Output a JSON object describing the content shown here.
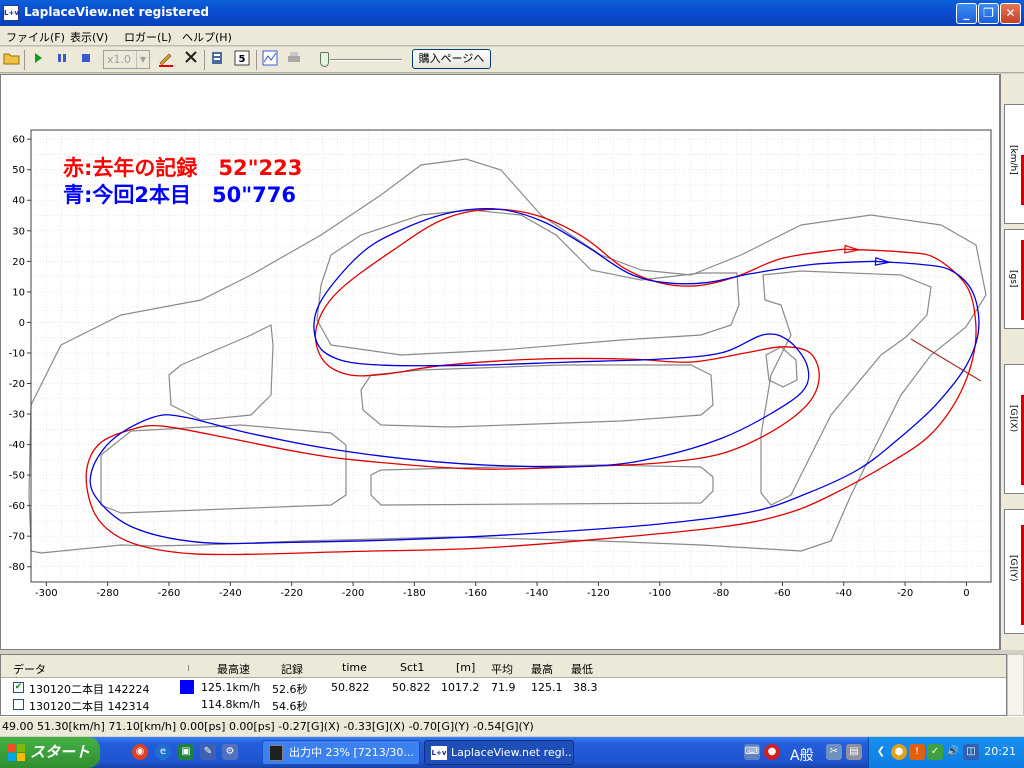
{
  "window": {
    "title": "LaplaceView.net registered",
    "icon_text": "L+v"
  },
  "menu": [
    "ファイル(F)",
    "表示(V)",
    "ロガー(L)",
    "ヘルプ(H)"
  ],
  "toolbar": {
    "speed_value": "x1.0",
    "buy_button": "購入ページへ"
  },
  "chart_data": {
    "type": "line",
    "xlim": [
      -305,
      8
    ],
    "ylim": [
      -85,
      63
    ],
    "x_ticks": [
      -300,
      -280,
      -260,
      -240,
      -220,
      -200,
      -180,
      -160,
      -140,
      -120,
      -100,
      -80,
      -60,
      -40,
      -20,
      0
    ],
    "y_ticks": [
      60,
      50,
      40,
      30,
      20,
      10,
      0,
      -10,
      -20,
      -30,
      -40,
      -50,
      -60,
      -70,
      -80
    ],
    "grid": true,
    "annotations": [
      {
        "text": "赤:去年の記録　52\"223",
        "color": "#ff0000"
      },
      {
        "text": "青:今回2本目　50\"776",
        "color": "#0000ff"
      }
    ],
    "series": [
      {
        "name": "赤:去年の記録",
        "color": "#e00000",
        "points": [
          [
            -40,
            24
          ],
          [
            -20,
            23
          ],
          [
            -10,
            21
          ],
          [
            0,
            12
          ],
          [
            3,
            0
          ],
          [
            2,
            -12
          ],
          [
            -3,
            -25
          ],
          [
            -12,
            -37
          ],
          [
            -25,
            -46
          ],
          [
            -45,
            -57
          ],
          [
            -60,
            -63
          ],
          [
            -80,
            -67
          ],
          [
            -120,
            -71
          ],
          [
            -160,
            -74
          ],
          [
            -200,
            -75
          ],
          [
            -240,
            -76
          ],
          [
            -260,
            -75
          ],
          [
            -275,
            -71
          ],
          [
            -284,
            -63
          ],
          [
            -287,
            -50
          ],
          [
            -283,
            -40
          ],
          [
            -272,
            -35
          ],
          [
            -262,
            -34
          ],
          [
            -240,
            -38
          ],
          [
            -220,
            -42
          ],
          [
            -200,
            -45
          ],
          [
            -160,
            -48
          ],
          [
            -120,
            -47
          ],
          [
            -100,
            -46
          ],
          [
            -80,
            -43
          ],
          [
            -64,
            -36
          ],
          [
            -52,
            -27
          ],
          [
            -48,
            -18
          ],
          [
            -51,
            -10
          ],
          [
            -60,
            -8
          ],
          [
            -72,
            -10
          ],
          [
            -90,
            -13
          ],
          [
            -110,
            -12
          ],
          [
            -140,
            -12
          ],
          [
            -170,
            -14
          ],
          [
            -190,
            -17
          ],
          [
            -202,
            -17
          ],
          [
            -210,
            -12
          ],
          [
            -212,
            -2
          ],
          [
            -205,
            10
          ],
          [
            -185,
            25
          ],
          [
            -170,
            34
          ],
          [
            -155,
            37
          ],
          [
            -140,
            35
          ],
          [
            -125,
            28
          ],
          [
            -112,
            18
          ],
          [
            -100,
            13
          ],
          [
            -88,
            12
          ],
          [
            -75,
            15
          ],
          [
            -60,
            21
          ],
          [
            -40,
            24
          ]
        ]
      },
      {
        "name": "青:今回2本目",
        "color": "#0000e0",
        "points": [
          [
            -30,
            20
          ],
          [
            -15,
            19
          ],
          [
            -5,
            17
          ],
          [
            2,
            10
          ],
          [
            4,
            -2
          ],
          [
            0,
            -14
          ],
          [
            -10,
            -27
          ],
          [
            -22,
            -38
          ],
          [
            -35,
            -48
          ],
          [
            -52,
            -56
          ],
          [
            -70,
            -62
          ],
          [
            -100,
            -66
          ],
          [
            -140,
            -69
          ],
          [
            -180,
            -71
          ],
          [
            -220,
            -72
          ],
          [
            -250,
            -72
          ],
          [
            -272,
            -67
          ],
          [
            -284,
            -57
          ],
          [
            -285,
            -48
          ],
          [
            -278,
            -38
          ],
          [
            -265,
            -31
          ],
          [
            -255,
            -31
          ],
          [
            -235,
            -36
          ],
          [
            -210,
            -41
          ],
          [
            -180,
            -45
          ],
          [
            -150,
            -47
          ],
          [
            -120,
            -47
          ],
          [
            -100,
            -44
          ],
          [
            -80,
            -38
          ],
          [
            -64,
            -30
          ],
          [
            -53,
            -22
          ],
          [
            -52,
            -14
          ],
          [
            -58,
            -6
          ],
          [
            -66,
            -4
          ],
          [
            -80,
            -10
          ],
          [
            -100,
            -12
          ],
          [
            -130,
            -13
          ],
          [
            -160,
            -14
          ],
          [
            -190,
            -14
          ],
          [
            -205,
            -12
          ],
          [
            -212,
            -6
          ],
          [
            -211,
            6
          ],
          [
            -198,
            22
          ],
          [
            -185,
            30
          ],
          [
            -168,
            36
          ],
          [
            -152,
            37
          ],
          [
            -138,
            33
          ],
          [
            -124,
            25
          ],
          [
            -110,
            16
          ],
          [
            -98,
            13
          ],
          [
            -85,
            13
          ],
          [
            -70,
            16
          ],
          [
            -50,
            19
          ],
          [
            -30,
            20
          ]
        ]
      }
    ]
  },
  "side_panel": {
    "labels": [
      "[km/h]",
      "[gs]",
      "[G](X)",
      "[G](Y)"
    ]
  },
  "table": {
    "headers": [
      "データ",
      "",
      "最高速",
      "記録",
      "time",
      "Sct1",
      "[m]",
      "平均",
      "最高",
      "最低"
    ],
    "rows": [
      {
        "checked": true,
        "name": "130120二本目 142224",
        "color": "#0000ff",
        "top_speed": "125.1km/h",
        "record": "52.6秒",
        "time": "50.822",
        "sct1": "50.822",
        "distance": "1017.2",
        "avg": "71.9",
        "max": "125.1",
        "min": "38.3"
      },
      {
        "checked": false,
        "name": "130120二本目 142314",
        "color": "#ffffff",
        "top_speed": "114.8km/h",
        "record": "54.6秒",
        "time": "",
        "sct1": "",
        "distance": "",
        "avg": "",
        "max": "",
        "min": ""
      }
    ]
  },
  "status": "49.00  51.30[km/h]  71.10[km/h]  0.00[ps]  0.00[ps]  -0.27[G](X)  -0.33[G](X)  -0.70[G](Y)  -0.54[G](Y)",
  "taskbar": {
    "start": "スタート",
    "tasks": [
      "出力中 23% [7213/30...",
      "LaplaceView.net regi..."
    ],
    "ime": "A般",
    "clock": "20:21"
  }
}
